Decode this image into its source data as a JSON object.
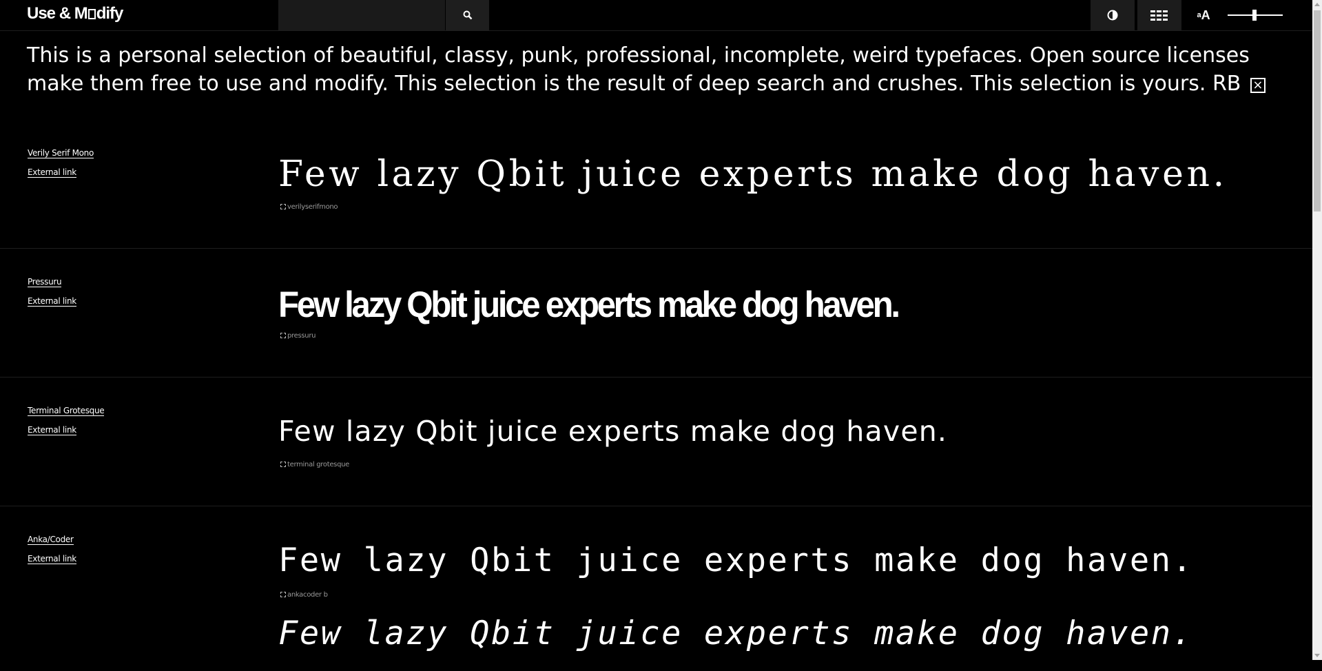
{
  "header": {
    "logo_prefix": "Use & M",
    "logo_suffix": "dify",
    "search_value": "",
    "search_icon": "search-icon",
    "contrast_icon": "contrast-icon",
    "grid_icon": "grid-view-icon",
    "size_small_label": "a",
    "size_big_label": "A",
    "size_slider_level": 0.5
  },
  "intro": {
    "text": "This is a personal selection of beautiful, classy, punk, professional, incomplete, weird typefaces. Open source licenses make them free to use and modify. This selection is the result of deep search and crushes. This selection is yours. RB",
    "close_label": "×"
  },
  "fonts": [
    {
      "name": "Verily Serif Mono",
      "link": "External link",
      "sample": "Few lazy Qbit juice experts make dog haven.",
      "tag": "verilyserifmono"
    },
    {
      "name": "Pressuru",
      "link": "External link",
      "sample": "Few lazy Qbit juice experts make dog haven.",
      "tag": "pressuru"
    },
    {
      "name": "Terminal Grotesque",
      "link": "External link",
      "sample": "Few lazy Qbit juice experts make dog haven.",
      "tag": "terminal grotesque"
    },
    {
      "name": "Anka/Coder",
      "link": "External link",
      "sample": "Few lazy Qbit juice experts make dog haven.",
      "tag": "ankacoder b",
      "sample_italic": "Few lazy Qbit juice experts make dog haven."
    }
  ]
}
